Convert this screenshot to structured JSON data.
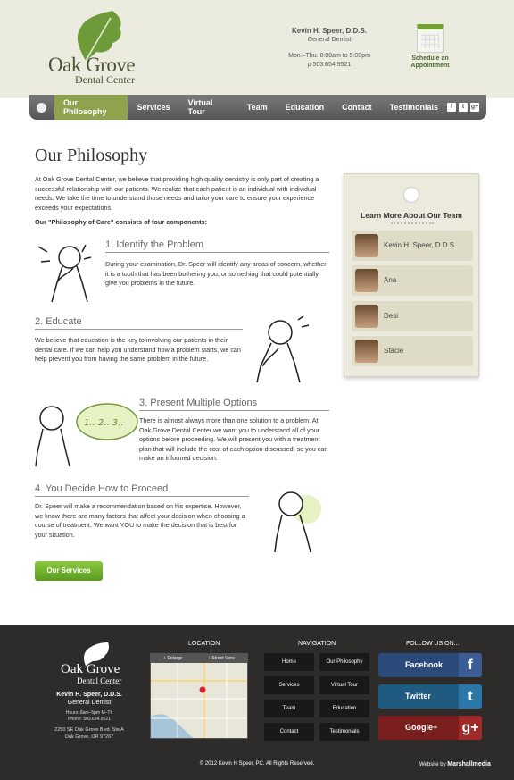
{
  "header": {
    "logo_line1": "Oak Grove",
    "logo_line2": "Dental Center",
    "doctor": "Kevin H. Speer, D.D.S.",
    "title": "General Dentist",
    "hours": "Mon.–Thu. 8:00am to 5:00pm",
    "phone": "p 503.654.9521",
    "schedule_label": "Schedule an Appointment"
  },
  "nav": {
    "items": [
      "Our Philosophy",
      "Services",
      "Virtual Tour",
      "Team",
      "Education",
      "Contact",
      "Testimonials"
    ],
    "active": "Our Philosophy",
    "social": [
      "f",
      "t",
      "g+"
    ]
  },
  "main": {
    "title": "Our Philosophy",
    "intro": "At Oak Grove Dental Center, we believe that providing high quality dentistry is only part of creating a successful relationship with our patients. We realize that each patient is an individual with individual needs. We take the time to understand those needs and tailor your care to ensure your experience exceeds your expectations.",
    "components_heading": "Our \"Philosophy of Care\" consists of four components:",
    "sections": [
      {
        "heading": "1. Identify the Problem",
        "text": "During your examination, Dr. Speer will identify any areas of concern, whether it is a tooth that has been bothering you, or something that could potentially give you problems in the future."
      },
      {
        "heading": "2. Educate",
        "text": "We believe that education is the key to involving our patients in their dental care. If we can help you understand how a problem starts, we can help prevent you from having the same problem in the future."
      },
      {
        "heading": "3. Present Multiple Options",
        "text": "There is almost always more than one solution to a problem. At Oak Grove Dental Center we want you to understand all of your options before proceeding. We will present you with a treatment plan that will include the cost of each option discussed, so you can make an informed decision."
      },
      {
        "heading": "4. You Decide How to Proceed",
        "text": "Dr. Speer will make a recommendation based on his expertise. However, we know there are many factors that affect your decision when choosing a course of treatment. We want YOU to make the decision that is best for your situation."
      }
    ],
    "bubble_text": "1.. 2.. 3..",
    "services_button": "Our Services"
  },
  "team": {
    "title": "Learn More About Our Team",
    "members": [
      "Kevin H. Speer, D.D.S.",
      "Ana",
      "Desi",
      "Stacie"
    ]
  },
  "footer": {
    "logo_line1": "Oak Grove",
    "logo_line2": "Dental Center",
    "doctor": "Kevin H. Speer, D.D.S.",
    "title": "General Dentist",
    "hours": "Hours: 8am–5pm M–Th",
    "phone": "Phone: 503.654.9521",
    "address1": "2250 SE Oak Grove Blvd. Ste A",
    "address2": "Oak Grove, OR 97267",
    "location_heading": "LOCATION",
    "map_enlarge": "+ Enlarge",
    "map_street": "+ Street View",
    "navigation_heading": "NAVIGATION",
    "nav_links": [
      "Home",
      "Our Philosophy",
      "Services",
      "Virtual Tour",
      "Team",
      "Education",
      "Contact",
      "Testimonials"
    ],
    "follow_heading": "FOLLOW US ON...",
    "social": [
      {
        "label": "Facebook",
        "icon": "f",
        "color": "#2a4a7a",
        "icon_color": "#3b5c94"
      },
      {
        "label": "Twitter",
        "icon": "t",
        "color": "#1f5a80",
        "icon_color": "#2b78a8"
      },
      {
        "label": "Google+",
        "icon": "g+",
        "color": "#7a1e1e",
        "icon_color": "#a02a2a"
      }
    ],
    "copyright": "© 2012 Kevin H Speer, PC. All Rights Reserved.",
    "website_by": "Website by",
    "agency": "Marshallmedia"
  }
}
